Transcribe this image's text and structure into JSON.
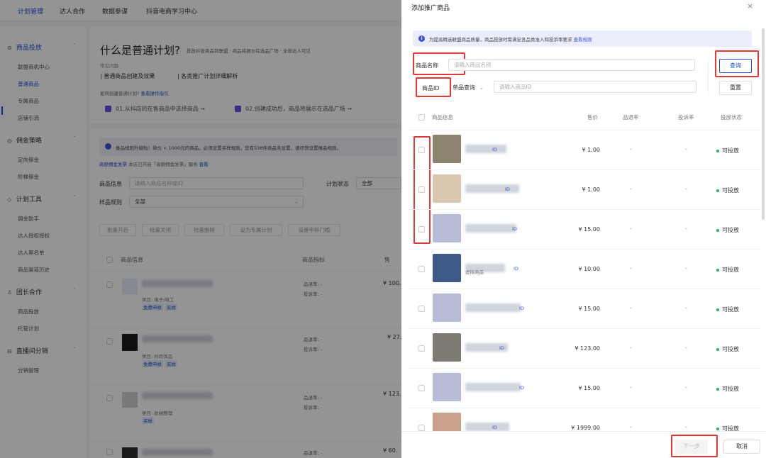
{
  "topnav": {
    "items": [
      "计划管理",
      "达人合作",
      "数据参谋",
      "抖音电商学习中心"
    ]
  },
  "sidebar": {
    "groups": [
      {
        "label": "商品投放",
        "items": [
          "联盟商机中心",
          "普通商品",
          "专属商品",
          "店铺引流"
        ]
      },
      {
        "label": "佣金策略",
        "items": [
          "定向佣金",
          "阶梯佣金"
        ]
      },
      {
        "label": "计划工具",
        "items": [
          "佣金助手",
          "达人授权授权",
          "达人黑名单",
          "商品渠道历史"
        ]
      },
      {
        "label": "团长合作",
        "items": [
          "商品投放",
          "托管计划"
        ]
      },
      {
        "label": "直播间分销",
        "items": [
          "分销管理"
        ]
      }
    ],
    "active_item": "普通商品"
  },
  "main": {
    "title": "什么是普通计划?",
    "title_sub": "投放抖音商品到联盟 · 商品将展示在选品广场 · 全部达人可见",
    "faq_label": "常见问题",
    "faq1": "普通商品创建及效果",
    "faq2": "各类推广计划详细解析",
    "howto": "如何创建普通计划?",
    "howto_link": "查看操作指引",
    "step1": "01.从抖店的在售商品中选择商品",
    "step2": "02.创建成功后，商品将展示在选品广场",
    "notice": "推品规则升级啦！单价 < 1000元的商品，必须设置买样规则，您有538件商品未设置，请尽快设置推品规则。",
    "notice2_link": "高额佣金发票",
    "notice2_text": "本店已开启「高额佣金发票」服务",
    "notice2_more": "查看",
    "filter_product_label": "商品信息",
    "filter_product_placeholder": "请输入商品名称或ID",
    "filter_status_label": "计划状态",
    "filter_status_value": "全部",
    "filter_rule_label": "样品规则",
    "filter_rule_value": "全部",
    "batch_buttons": [
      "批量开启",
      "批量关闭",
      "批量删除",
      "设为专属计划",
      "设置申样门槛"
    ],
    "col_info": "商品信息",
    "col_metric": "商品指标",
    "col_price": "售",
    "rows": [
      {
        "cat": "类目: 电子/电工",
        "tags": [
          "免费申样",
          "买样"
        ],
        "m1": "品退率: -",
        "m2": "投诉率: -",
        "price": "¥ 100."
      },
      {
        "cat": "类目: 时尚饰品",
        "tags": [
          "免费申样",
          "买样"
        ],
        "m1": "品退率: -",
        "m2": "投诉率: -",
        "price": "¥ 27."
      },
      {
        "cat": "类目: 收纳整理",
        "tags": [
          "买样"
        ],
        "m1": "品退率: -",
        "m2": "投诉率: -",
        "price": "¥ 123."
      },
      {
        "cat": "",
        "tags": [],
        "m1": "品退率: -",
        "m2": "投诉率: -",
        "price": "¥ 60."
      }
    ]
  },
  "drawer": {
    "title": "添加推广商品",
    "notice": "为提高精选联盟商品质量，商品投放时需满足各品类准入和投诉率要求",
    "notice_link": "查看规则",
    "name_label": "商品名称",
    "name_placeholder": "请输入商品名称",
    "id_label": "商品ID",
    "mode_select": "单品查询",
    "id_placeholder": "请输入商品ID",
    "query_button": "查询",
    "reset_button": "重置",
    "headers": {
      "info": "商品信息",
      "price": "售价",
      "return": "品退率",
      "complaint": "投诉率",
      "status": "投放状态"
    },
    "rows": [
      {
        "price": "¥ 1.00",
        "d1": "-",
        "d2": "-",
        "status": "可投放",
        "thumb": "#8d8470",
        "sub": ""
      },
      {
        "price": "¥ 1.00",
        "d1": "-",
        "d2": "-",
        "status": "可投放",
        "thumb": "#d9c7b0",
        "sub": ""
      },
      {
        "price": "¥ 15.00",
        "d1": "-",
        "d2": "-",
        "status": "可投放",
        "thumb": "#b8bdd6",
        "sub": ""
      },
      {
        "price": "¥ 10.00",
        "d1": "-",
        "d2": "-",
        "status": "可投放",
        "thumb": "#3e5a86",
        "sub": "虚拟商品"
      },
      {
        "price": "¥ 15.00",
        "d1": "-",
        "d2": "-",
        "status": "可投放",
        "thumb": "#b8bdd6",
        "sub": ""
      },
      {
        "price": "¥ 123.00",
        "d1": "-",
        "d2": "-",
        "status": "可投放",
        "thumb": "#7d7a74",
        "sub": ""
      },
      {
        "price": "¥ 15.00",
        "d1": "-",
        "d2": "-",
        "status": "可投放",
        "thumb": "#b8bdd6",
        "sub": ""
      },
      {
        "price": "¥ 1999.00",
        "d1": "-",
        "d2": "-",
        "status": "可投放",
        "thumb": "#c9a08a",
        "sub": ""
      }
    ],
    "next_button": "下一步",
    "cancel_button": "取消"
  },
  "colors": {
    "accent": "#1a4ed6",
    "highlight": "#e53935",
    "ok": "#28b464"
  }
}
